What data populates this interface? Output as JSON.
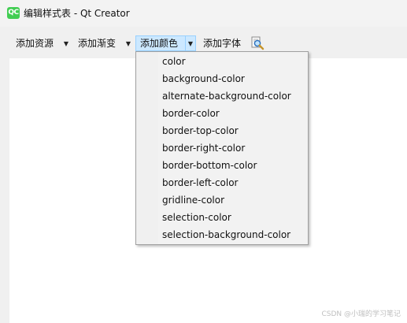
{
  "window": {
    "app_icon_text": "QC",
    "title": "编辑样式表 - Qt Creator"
  },
  "toolbar": {
    "add_resource": "添加资源",
    "add_gradient": "添加渐变",
    "add_color": "添加颜色",
    "add_font": "添加字体",
    "dropdown_arrow": "▼"
  },
  "color_menu": {
    "items": [
      "color",
      "background-color",
      "alternate-background-color",
      "border-color",
      "border-top-color",
      "border-right-color",
      "border-bottom-color",
      "border-left-color",
      "gridline-color",
      "selection-color",
      "selection-background-color"
    ]
  },
  "watermark": "CSDN @小瑞的学习笔记",
  "colors": {
    "app_icon": "#41cd52",
    "active_button_bg": "#cce8ff",
    "active_button_border": "#99d1ff",
    "menu_bg": "#f2f2f2",
    "editor_bg": "#ffffff"
  },
  "icons": {
    "app": "qt-creator-icon",
    "search": "magnifier-icon"
  }
}
